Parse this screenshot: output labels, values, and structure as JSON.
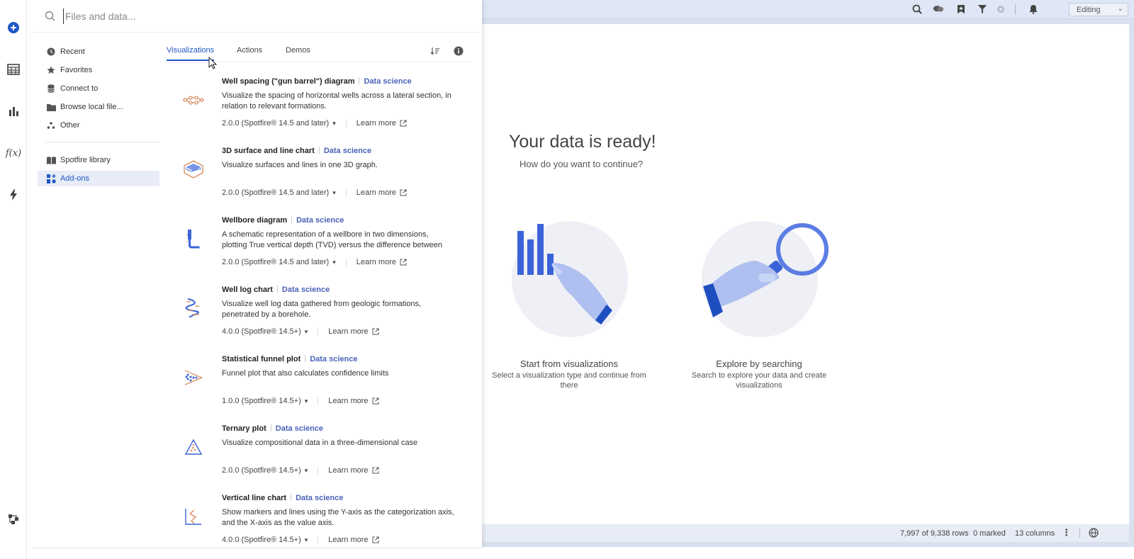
{
  "search": {
    "placeholder": "Files and data..."
  },
  "nav": {
    "items": [
      {
        "label": "Recent",
        "icon": "clock-icon"
      },
      {
        "label": "Favorites",
        "icon": "star-icon"
      },
      {
        "label": "Connect to",
        "icon": "database-icon"
      },
      {
        "label": "Browse local file...",
        "icon": "folder-icon"
      },
      {
        "label": "Other",
        "icon": "dots-icon"
      }
    ],
    "library": {
      "label": "Spotfire library",
      "icon": "book-icon"
    },
    "addons": {
      "label": "Add-ons",
      "icon": "addons-icon",
      "active": true
    }
  },
  "tabs": [
    {
      "label": "Visualizations",
      "active": true
    },
    {
      "label": "Actions"
    },
    {
      "label": "Demos"
    }
  ],
  "cards": [
    {
      "title": "Well spacing (\"gun barrel\") diagram",
      "tag": "Data science",
      "desc": "Visualize the spacing of horizontal wells across a lateral section, in relation to relevant formations.",
      "version": "2.0.0 (Spotfire® 14.5 and later)",
      "learn": "Learn more",
      "icon": "gun-barrel-icon"
    },
    {
      "title": "3D surface and line chart",
      "tag": "Data science",
      "desc": "Visualize surfaces and lines in one 3D graph.",
      "version": "2.0.0 (Spotfire® 14.5 and later)",
      "learn": "Learn more",
      "icon": "surface-3d-icon"
    },
    {
      "title": "Wellbore diagram",
      "tag": "Data science",
      "desc": "A schematic representation of a wellbore in two dimensions, plotting True vertical depth (TVD) versus the difference between Measured depth (MD)...",
      "version": "2.0.0 (Spotfire® 14.5 and later)",
      "learn": "Learn more",
      "icon": "wellbore-icon"
    },
    {
      "title": "Well log chart",
      "tag": "Data science",
      "desc": "Visualize well log data gathered from geologic formations, penetrated by a borehole.",
      "version": "4.0.0 (Spotfire® 14.5+)",
      "learn": "Learn more",
      "icon": "well-log-icon"
    },
    {
      "title": "Statistical funnel plot",
      "tag": "Data science",
      "desc": "Funnel plot that also calculates confidence limits",
      "version": "1.0.0 (Spotfire® 14.5+)",
      "learn": "Learn more",
      "icon": "funnel-plot-icon"
    },
    {
      "title": "Ternary plot",
      "tag": "Data science",
      "desc": "Visualize compositional data in a three-dimensional case",
      "version": "2.0.0 (Spotfire® 14.5+)",
      "learn": "Learn more",
      "icon": "ternary-plot-icon"
    },
    {
      "title": "Vertical line chart",
      "tag": "Data science",
      "desc": "Show markers and lines using the Y-axis as the categorization axis, and the X-axis as the value axis.",
      "version": "4.0.0 (Spotfire® 14.5+)",
      "learn": "Learn more",
      "icon": "vertical-line-icon"
    }
  ],
  "welcome": {
    "title": "Your data is ready!",
    "subtitle": "How do you want to continue?",
    "options": [
      {
        "title": "Start from visualizations",
        "desc": "Select a visualization type and continue from there"
      },
      {
        "title": "Explore by searching",
        "desc": "Search to explore your data and create visualizations"
      }
    ]
  },
  "topbar": {
    "mode": "Editing"
  },
  "status": {
    "rows": "7,997 of 9,338 rows",
    "marked": "0 marked",
    "columns": "13 columns"
  },
  "colors": {
    "accent": "#1f57c7",
    "tag": "#4a62b8",
    "illustration": "#3b63d9"
  }
}
